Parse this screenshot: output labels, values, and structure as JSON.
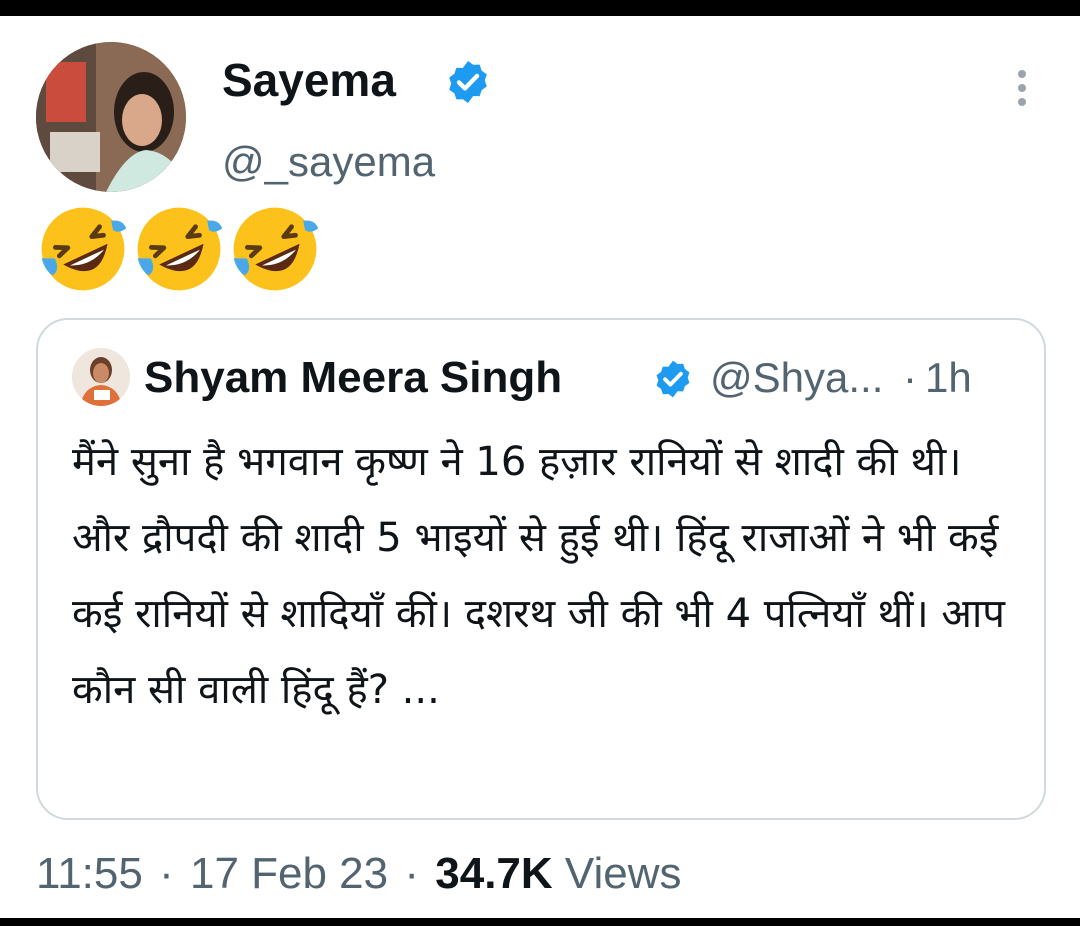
{
  "author": {
    "display_name": "Sayema",
    "handle": "@_sayema",
    "verified_icon": "verified-badge-icon",
    "emoji_icons": [
      "rolling-on-floor-laughing-emoji",
      "rolling-on-floor-laughing-emoji",
      "rolling-on-floor-laughing-emoji"
    ]
  },
  "quoted_tweet": {
    "display_name": "Shyam Meera Singh",
    "handle_truncated": "@Shya...",
    "separator": "·",
    "time": "1h",
    "text": "मैंने सुना है भगवान कृष्ण ने 16 हज़ार रानियों से शादी की थी। और द्रौपदी की शादी 5 भाइयों से हुई थी। हिंदू राजाओं ने भी कई कई रानियों से शादियाँ कीं। दशरथ जी की भी 4 पत्नियाँ थीं। आप कौन सी वाली हिंदू हैं? ..."
  },
  "footer": {
    "time": "11:55",
    "date": "17 Feb 23",
    "views_count": "34.7K",
    "views_label": "Views",
    "separator": "·"
  },
  "colors": {
    "verified_blue": "#1d9bf0",
    "secondary_text": "#536471",
    "border": "#cfd9de"
  }
}
